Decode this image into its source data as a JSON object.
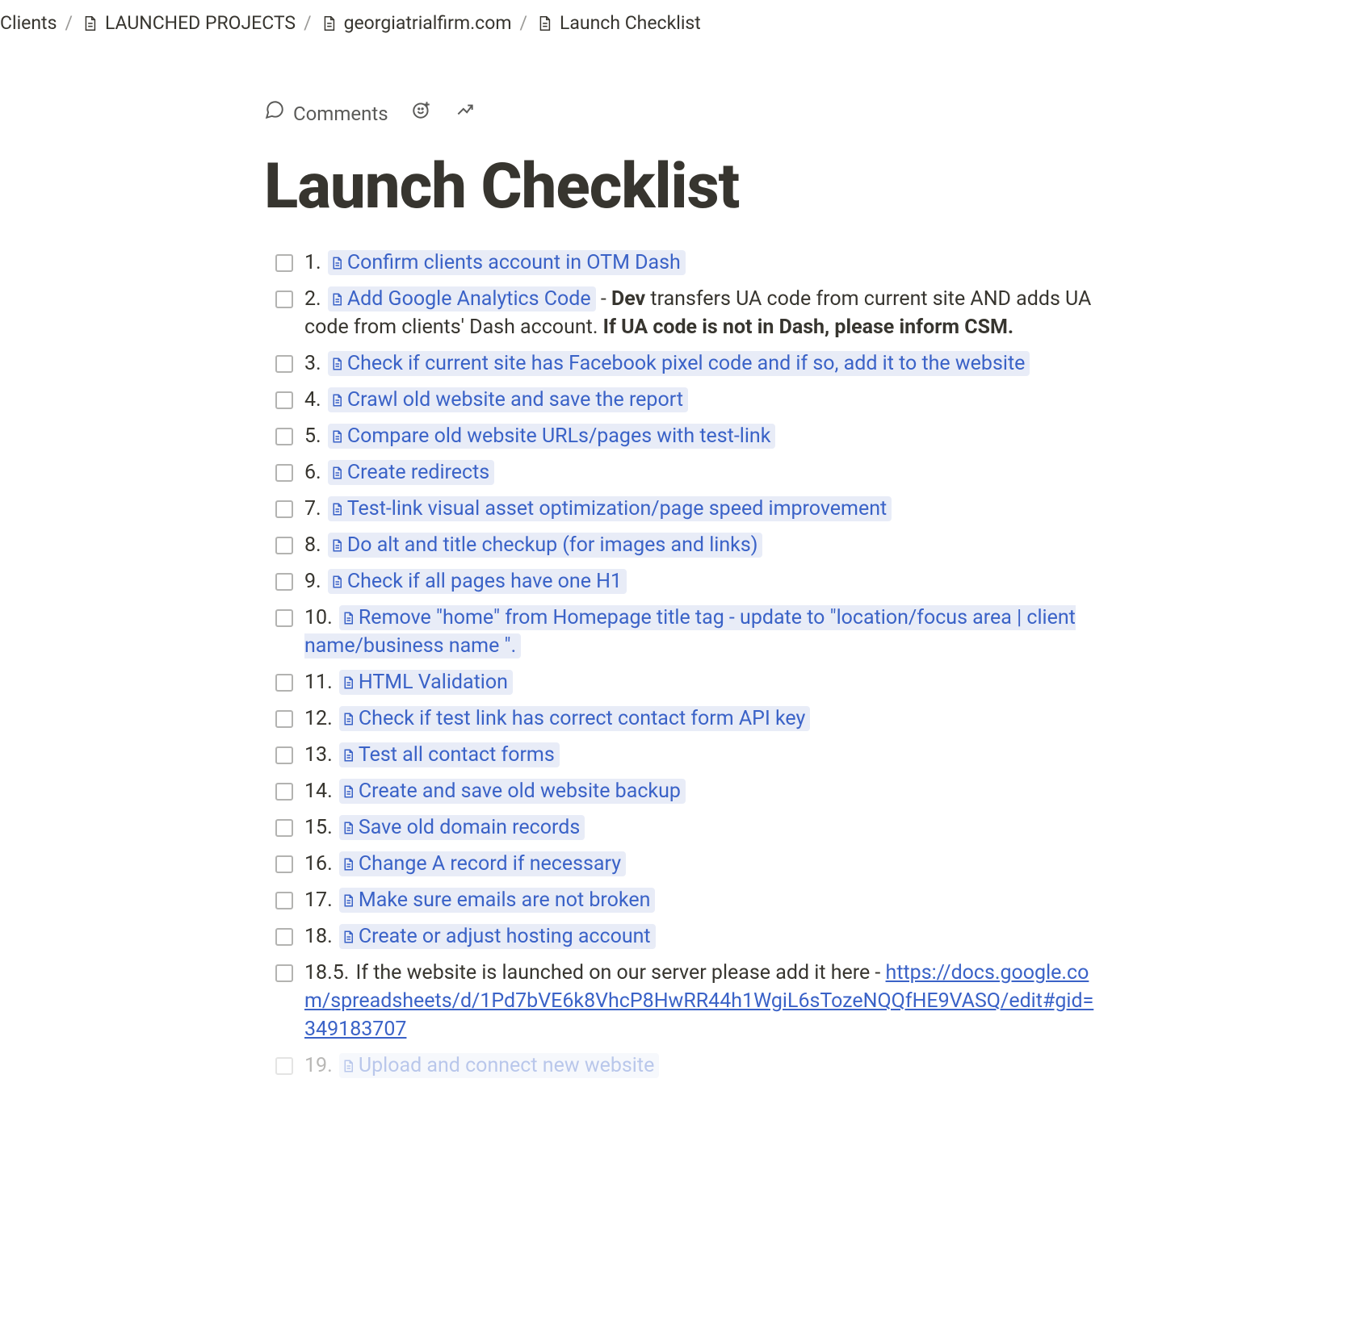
{
  "breadcrumb": {
    "items": [
      {
        "label": "Clients",
        "hasIcon": false
      },
      {
        "label": "LAUNCHED PROJECTS",
        "hasIcon": true
      },
      {
        "label": "georgiatrialfirm.com",
        "hasIcon": true
      },
      {
        "label": "Launch Checklist",
        "hasIcon": true
      }
    ]
  },
  "toolbar": {
    "comments_label": "Comments"
  },
  "page": {
    "title": "Launch Checklist"
  },
  "checklist": [
    {
      "num": "1.",
      "link": "Confirm clients account in OTM Dash"
    },
    {
      "num": "2.",
      "link": "Add Google Analytics Code",
      "suffix_html": "  - <span class=\"bold\">Dev</span> transfers UA code from current site AND adds UA code from clients' Dash account. <span class=\"bold\">If UA code is not in Dash, please inform CSM.</span>"
    },
    {
      "num": "3.",
      "link": "Check if current site has Facebook pixel code and if so, add it to the website"
    },
    {
      "num": "4.",
      "link": "Crawl old website and save the report"
    },
    {
      "num": "5.",
      "link": "Compare old website URLs/pages with test-link"
    },
    {
      "num": "6.",
      "link": "Create redirects"
    },
    {
      "num": "7.",
      "link": "Test-link visual asset optimization/page speed improvement"
    },
    {
      "num": "8.",
      "link": "Do alt and title checkup (for images and links)"
    },
    {
      "num": "9.",
      "link": "Check if all pages have one H1"
    },
    {
      "num": "10.",
      "link": "Remove \"home\" from Homepage title tag - update to \"location/focus area | client name/business name \"."
    },
    {
      "num": "11.",
      "link": "HTML Validation"
    },
    {
      "num": "12.",
      "link": "Check if test link has correct contact form API key"
    },
    {
      "num": "13.",
      "link": "Test all contact forms"
    },
    {
      "num": "14.",
      "link": "Create and save old website backup"
    },
    {
      "num": "15.",
      "link": "Save old domain records"
    },
    {
      "num": "16.",
      "link": "Change A record if necessary"
    },
    {
      "num": "17.",
      "link": "Make sure emails are not broken"
    },
    {
      "num": "18.",
      "link": "Create or adjust hosting account"
    },
    {
      "num": "18.5.",
      "plain_prefix": "If the website is launched on our server please add it here - ",
      "plain_link": "https://docs.google.com/spreadsheets/d/1Pd7bVE6k8VhcP8HwRR44h1WgiL6sTozeNQQfHE9VASQ/edit#gid=349183707"
    },
    {
      "num": "19.",
      "link": "Upload and connect new website",
      "cut": true
    }
  ]
}
